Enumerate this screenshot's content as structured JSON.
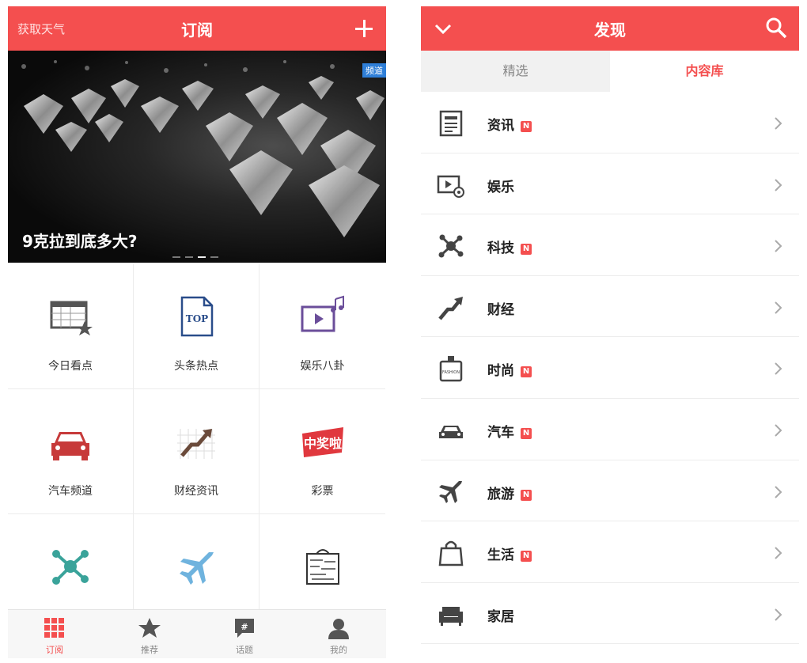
{
  "left": {
    "header": {
      "weather": "获取天气",
      "title": "订阅"
    },
    "banner": {
      "badge": "频道",
      "title": "9克拉到底多大?",
      "dots": 4,
      "active_dot": 2
    },
    "grid": [
      {
        "label": "今日看点",
        "icon": "calendar-star-icon"
      },
      {
        "label": "头条热点",
        "icon": "top-document-icon"
      },
      {
        "label": "娱乐八卦",
        "icon": "video-music-icon"
      },
      {
        "label": "汽车频道",
        "icon": "car-icon"
      },
      {
        "label": "财经资讯",
        "icon": "finance-arrow-icon"
      },
      {
        "label": "彩票",
        "icon": "lottery-badge-icon"
      },
      {
        "label": "",
        "icon": "molecule-icon"
      },
      {
        "label": "",
        "icon": "airplane-icon"
      },
      {
        "label": "",
        "icon": "fashion-bag-icon"
      }
    ],
    "lottery_text": "中奖啦",
    "nav": [
      {
        "label": "订阅",
        "icon": "grid-icon",
        "active": true
      },
      {
        "label": "推荐",
        "icon": "star-icon",
        "active": false
      },
      {
        "label": "话题",
        "icon": "topic-icon",
        "active": false
      },
      {
        "label": "我的",
        "icon": "user-icon",
        "active": false
      }
    ]
  },
  "right": {
    "header": {
      "title": "发现"
    },
    "tabs": [
      {
        "label": "精选"
      },
      {
        "label": "内容库"
      }
    ],
    "badge_text": "N",
    "fashion_text": "FASHION",
    "rows": [
      {
        "label": "资讯",
        "badge": true,
        "icon": "news-icon"
      },
      {
        "label": "娱乐",
        "badge": false,
        "icon": "entertainment-icon"
      },
      {
        "label": "科技",
        "badge": true,
        "icon": "tech-icon"
      },
      {
        "label": "财经",
        "badge": false,
        "icon": "finance-icon"
      },
      {
        "label": "时尚",
        "badge": true,
        "icon": "perfume-icon"
      },
      {
        "label": "汽车",
        "badge": true,
        "icon": "car-icon"
      },
      {
        "label": "旅游",
        "badge": true,
        "icon": "travel-icon"
      },
      {
        "label": "生活",
        "badge": true,
        "icon": "shopping-bag-icon"
      },
      {
        "label": "家居",
        "badge": false,
        "icon": "sofa-icon"
      }
    ]
  },
  "colors": {
    "accent": "#f44f4f",
    "banner_badge": "#2f7fd8"
  }
}
